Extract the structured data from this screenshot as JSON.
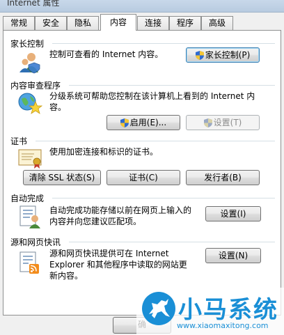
{
  "window": {
    "title": "Internet 属性"
  },
  "tabs": [
    {
      "label": "常规"
    },
    {
      "label": "安全"
    },
    {
      "label": "隐私"
    },
    {
      "label": "内容"
    },
    {
      "label": "连接"
    },
    {
      "label": "程序"
    },
    {
      "label": "高级"
    }
  ],
  "parental": {
    "title": "家长控制",
    "description": "控制可查看的 Internet 内容。",
    "button": "家长控制(P)"
  },
  "advisor": {
    "title": "内容审查程序",
    "description": "分级系统可帮助您控制在该计算机上看到的 Internet 内容。",
    "enable_button": "启用(E)...",
    "settings_button": "设置(T)"
  },
  "certificates": {
    "title": "证书",
    "description": "使用加密连接和标识的证书。",
    "clear_ssl_button": "清除 SSL 状态(S)",
    "certificates_button": "证书(C)",
    "publishers_button": "发行者(B)"
  },
  "autocomplete": {
    "title": "自动完成",
    "description": "自动完成功能存储以前在网页上输入的内容并向您建议匹配项。",
    "settings_button": "设置(I)"
  },
  "feeds": {
    "title": "源和网页快讯",
    "description": "源和网页快讯提供可在 Internet Explorer 和其他程序中读取的网站更新内容。",
    "settings_button": "设置(N)"
  },
  "footer": {
    "ok_button": "确"
  },
  "watermark": {
    "title": "小马系统",
    "url": "www.xiaomaxitong.com"
  },
  "colors": {
    "watermark_blue": "#1a8fd6",
    "tab_border": "#8e8f8f",
    "group_line": "#d5dfe5"
  }
}
